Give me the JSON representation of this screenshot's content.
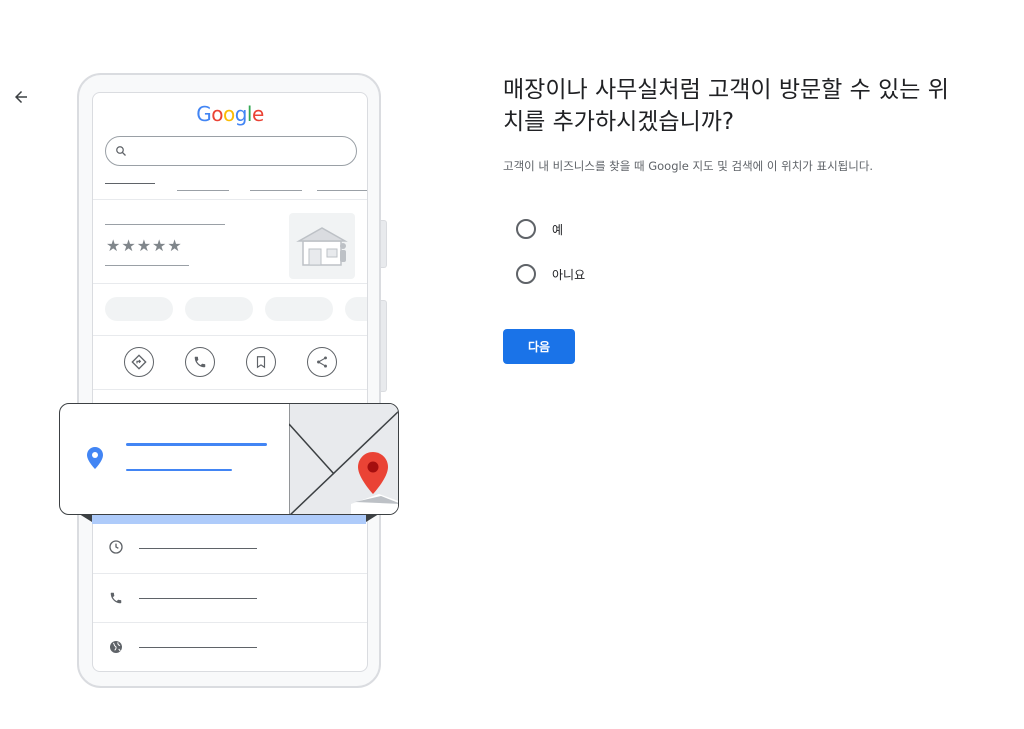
{
  "nav": {
    "back_icon": "arrow-left-icon"
  },
  "illustration": {
    "logo_letters": [
      {
        "ch": "G",
        "color": "#4285f4"
      },
      {
        "ch": "o",
        "color": "#ea4335"
      },
      {
        "ch": "o",
        "color": "#fbbc05"
      },
      {
        "ch": "g",
        "color": "#4285f4"
      },
      {
        "ch": "l",
        "color": "#34a853"
      },
      {
        "ch": "e",
        "color": "#ea4335"
      }
    ],
    "stars": "★★★★★",
    "pin_color": "#4285f4",
    "map_pin_color": "#ea4335",
    "accent_line_color": "#4285f4"
  },
  "form": {
    "title": "매장이나 사무실처럼 고객이 방문할 수 있는 위치를 추가하시겠습니까?",
    "subtitle": "고객이 내 비즈니스를 찾을 때 Google 지도 및 검색에 이 위치가 표시됩니다.",
    "options": [
      {
        "label": "예",
        "selected": false
      },
      {
        "label": "아니요",
        "selected": false
      }
    ],
    "next_label": "다음",
    "accent_color": "#1a73e8"
  }
}
